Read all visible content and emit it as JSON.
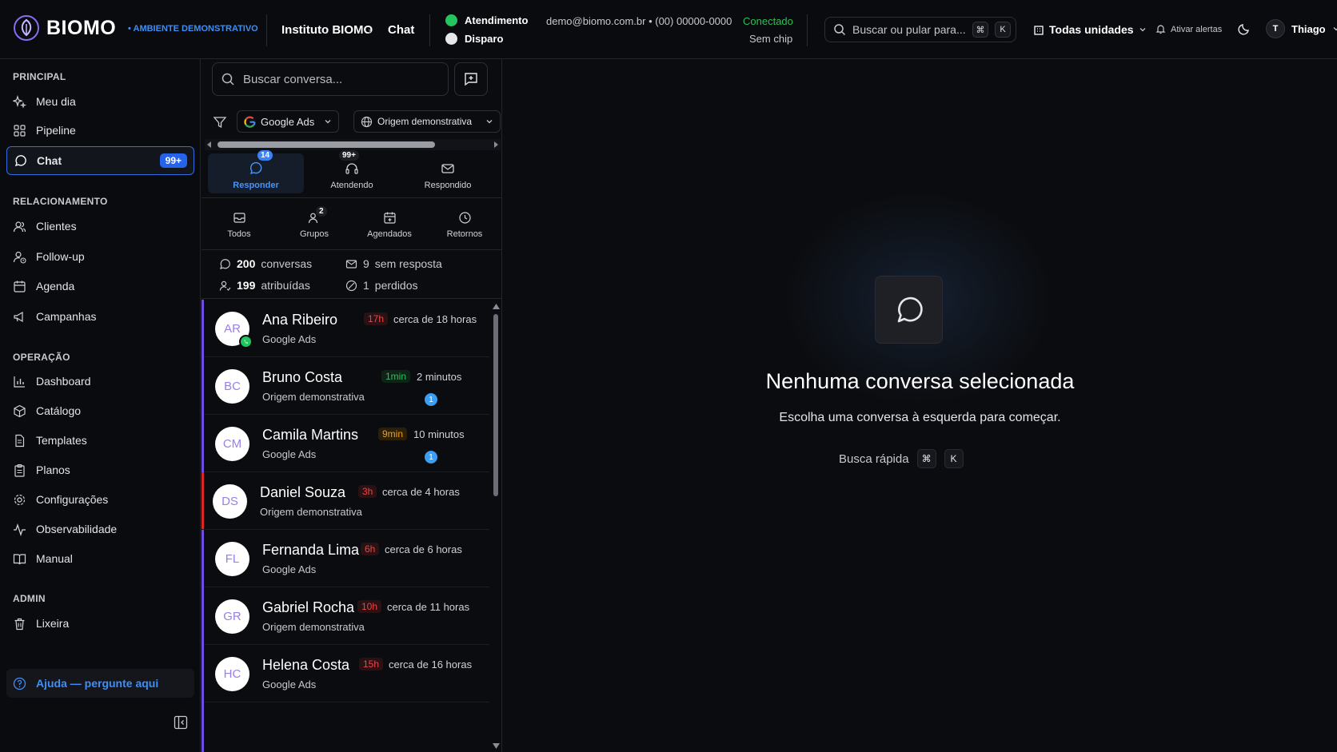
{
  "header": {
    "brand": "BIOMO",
    "environment": "• AMBIENTE DEMONSTRATIVO",
    "breadcrumb": [
      "Instituto BIOMO",
      "Chat"
    ],
    "channels": [
      {
        "label": "Atendimento",
        "color": "#22c55e",
        "selected": true
      },
      {
        "label": "Disparo",
        "color": "#e5e7eb",
        "selected": false
      }
    ],
    "contact": "demo@biomo.com.br • (00) 00000-0000",
    "status": "Conectado",
    "chip": "Sem chip",
    "search_placeholder": "Buscar ou pular para...",
    "search_shortcut": [
      "⌘",
      "K"
    ],
    "units": "Todas unidades",
    "alerts": "Ativar alertas",
    "user_initial": "T",
    "user_name": "Thiago"
  },
  "sidebar": {
    "sections": [
      {
        "title": "PRINCIPAL",
        "items": [
          {
            "label": "Meu dia",
            "icon": "sparkles-icon"
          },
          {
            "label": "Pipeline",
            "icon": "grid-icon"
          },
          {
            "label": "Chat",
            "icon": "chat-icon",
            "active": true,
            "badge": "99+"
          }
        ]
      },
      {
        "title": "RELACIONAMENTO",
        "items": [
          {
            "label": "Clientes",
            "icon": "users-icon"
          },
          {
            "label": "Follow-up",
            "icon": "user-clock-icon"
          },
          {
            "label": "Agenda",
            "icon": "calendar-icon"
          },
          {
            "label": "Campanhas",
            "icon": "megaphone-icon"
          }
        ]
      },
      {
        "title": "OPERAÇÃO",
        "items": [
          {
            "label": "Dashboard",
            "icon": "bar-chart-icon"
          },
          {
            "label": "Catálogo",
            "icon": "package-icon"
          },
          {
            "label": "Templates",
            "icon": "file-icon"
          },
          {
            "label": "Planos",
            "icon": "clipboard-icon"
          },
          {
            "label": "Configurações",
            "icon": "gear-icon"
          },
          {
            "label": "Observabilidade",
            "icon": "activity-icon"
          },
          {
            "label": "Manual",
            "icon": "book-icon"
          }
        ]
      },
      {
        "title": "ADMIN",
        "items": [
          {
            "label": "Lixeira",
            "icon": "trash-icon"
          }
        ]
      }
    ],
    "help": "Ajuda — pergunte aqui"
  },
  "conversations": {
    "search_placeholder": "Buscar conversa...",
    "filters": {
      "source": "Google Ads",
      "origin": "Origem demonstrativa"
    },
    "tabs_primary": [
      {
        "label": "Responder",
        "badge": "14",
        "active": true
      },
      {
        "label": "Atendendo",
        "badge": "99+"
      },
      {
        "label": "Respondido",
        "badge": ""
      }
    ],
    "tabs_secondary": [
      {
        "label": "Todos",
        "badge": ""
      },
      {
        "label": "Grupos",
        "badge": "2"
      },
      {
        "label": "Agendados",
        "badge": ""
      },
      {
        "label": "Retornos",
        "badge": ""
      }
    ],
    "stats": {
      "conversations_count": "200",
      "conversations_label": "conversas",
      "unanswered_count": "9",
      "unanswered_label": "sem resposta",
      "assigned_count": "199",
      "assigned_label": "atribuídas",
      "lost_count": "1",
      "lost_label": "perdidos"
    },
    "items": [
      {
        "initials": "AR",
        "name": "Ana Ribeiro",
        "source": "Google Ads",
        "age": "17h",
        "age_color": "red",
        "time": "cerca de 18 horas",
        "unread": "",
        "whatsapp": true,
        "accent": "#6d4ee0"
      },
      {
        "initials": "BC",
        "name": "Bruno Costa",
        "source": "Origem demonstrativa",
        "age": "1min",
        "age_color": "green",
        "time": "2 minutos",
        "unread": "1",
        "whatsapp": false,
        "accent": "#6d4ee0"
      },
      {
        "initials": "CM",
        "name": "Camila Martins",
        "source": "Google Ads",
        "age": "9min",
        "age_color": "orange",
        "time": "10 minutos",
        "unread": "1",
        "whatsapp": false,
        "accent": "#6d4ee0"
      },
      {
        "initials": "DS",
        "name": "Daniel Souza",
        "source": "Origem demonstrativa",
        "age": "3h",
        "age_color": "red",
        "time": "cerca de 4 horas",
        "unread": "",
        "whatsapp": false,
        "accent": "#dc2626"
      },
      {
        "initials": "FL",
        "name": "Fernanda Lima",
        "source": "Google Ads",
        "age": "6h",
        "age_color": "red",
        "time": "cerca de 6 horas",
        "unread": "",
        "whatsapp": false,
        "accent": "#6d4ee0"
      },
      {
        "initials": "GR",
        "name": "Gabriel Rocha",
        "source": "Origem demonstrativa",
        "age": "10h",
        "age_color": "red",
        "time": "cerca de 11 horas",
        "unread": "",
        "whatsapp": false,
        "accent": "#6d4ee0"
      },
      {
        "initials": "HC",
        "name": "Helena Costa",
        "source": "Google Ads",
        "age": "15h",
        "age_color": "red",
        "time": "cerca de 16 horas",
        "unread": "",
        "whatsapp": false,
        "accent": "#6d4ee0"
      }
    ]
  },
  "empty_state": {
    "title": "Nenhuma conversa selecionada",
    "subtitle": "Escolha uma conversa à esquerda para começar.",
    "quick_search": "Busca rápida",
    "shortcut": [
      "⌘",
      "K"
    ]
  }
}
